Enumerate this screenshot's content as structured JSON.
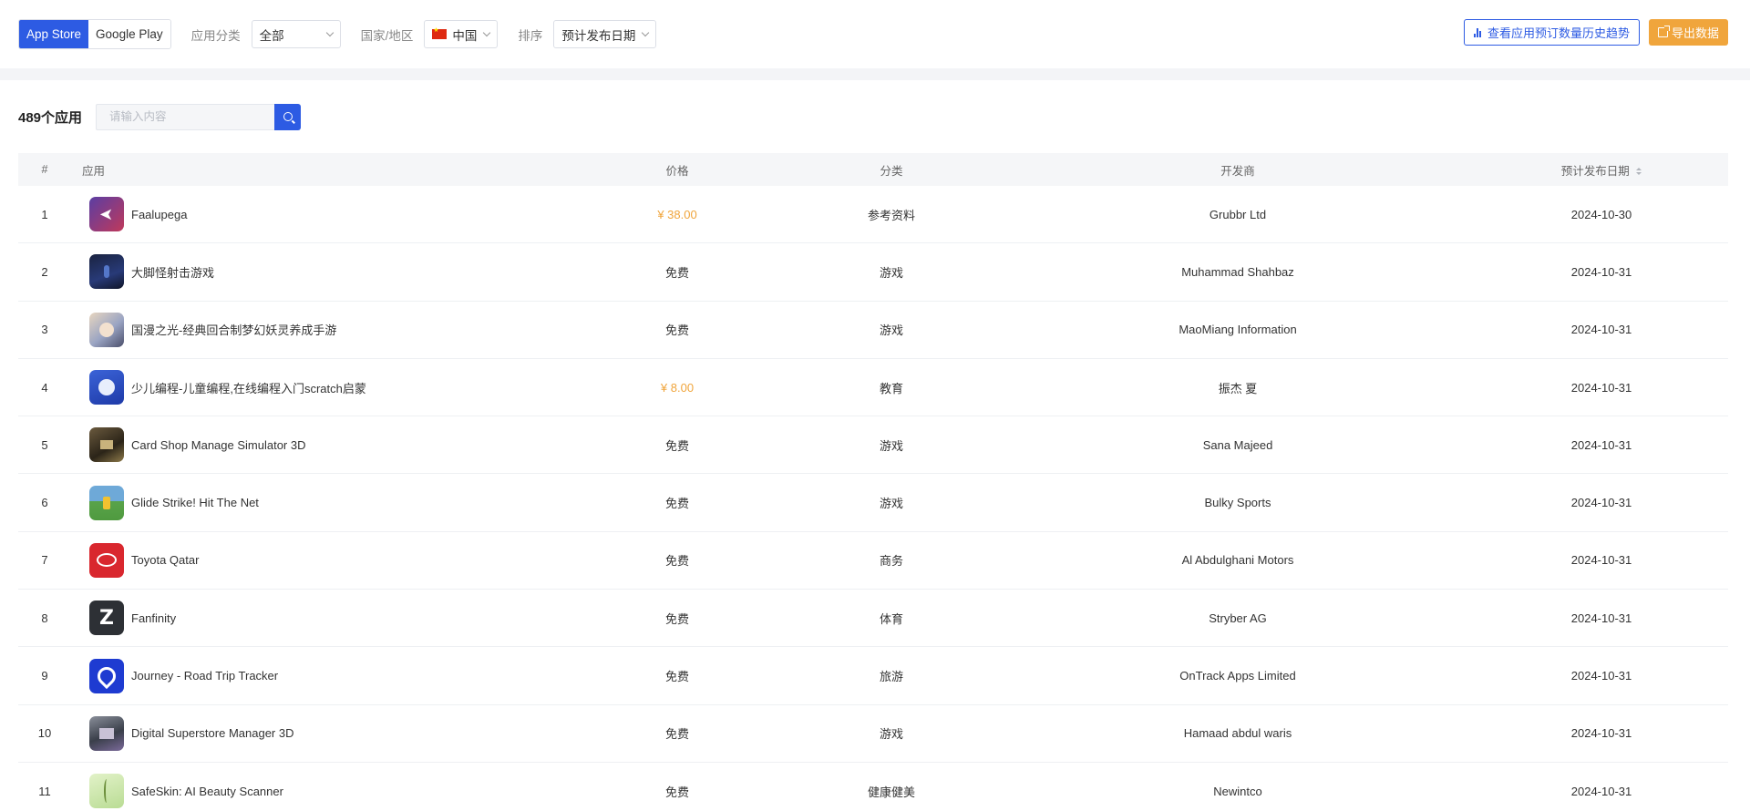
{
  "filters": {
    "store_tabs": [
      {
        "label": "App Store",
        "active": true
      },
      {
        "label": "Google Play",
        "active": false
      }
    ],
    "category_label": "应用分类",
    "category_value": "全部",
    "region_label": "国家/地区",
    "region_value": "中国",
    "sort_label": "排序",
    "sort_value": "预计发布日期"
  },
  "actions": {
    "trend_button": "查看应用预订数量历史趋势",
    "export_button": "导出数据"
  },
  "summary": {
    "app_count": "489个应用",
    "search_placeholder": "请输入内容"
  },
  "table": {
    "columns": {
      "num": "#",
      "app": "应用",
      "price": "价格",
      "category": "分类",
      "developer": "开发商",
      "date": "预计发布日期"
    },
    "rows": [
      {
        "num": "1",
        "name": "Faalupega",
        "price": "¥ 38.00",
        "paid": true,
        "category": "参考资料",
        "developer": "Grubbr Ltd",
        "date": "2024-10-30",
        "icon": "faalupega-app-icon"
      },
      {
        "num": "2",
        "name": "大脚怪射击游戏",
        "price": "免费",
        "paid": false,
        "category": "游戏",
        "developer": "Muhammad Shahbaz",
        "date": "2024-10-31",
        "icon": "bigfoot-shooter-app-icon"
      },
      {
        "num": "3",
        "name": "国漫之光-经典回合制梦幻妖灵养成手游",
        "price": "免费",
        "paid": false,
        "category": "游戏",
        "developer": "MaoMiang Information",
        "date": "2024-10-31",
        "icon": "anime-rpg-app-icon"
      },
      {
        "num": "4",
        "name": "少儿编程-儿童编程,在线编程入门scratch启蒙",
        "price": "¥ 8.00",
        "paid": true,
        "category": "教育",
        "developer": "振杰 夏",
        "date": "2024-10-31",
        "icon": "kids-coding-robot-app-icon"
      },
      {
        "num": "5",
        "name": "Card Shop Manage Simulator 3D",
        "price": "免费",
        "paid": false,
        "category": "游戏",
        "developer": "Sana Majeed",
        "date": "2024-10-31",
        "icon": "card-shop-app-icon"
      },
      {
        "num": "6",
        "name": "Glide Strike! Hit The Net",
        "price": "免费",
        "paid": false,
        "category": "游戏",
        "developer": "Bulky Sports",
        "date": "2024-10-31",
        "icon": "soccer-game-app-icon"
      },
      {
        "num": "7",
        "name": "Toyota Qatar",
        "price": "免费",
        "paid": false,
        "category": "商务",
        "developer": "Al Abdulghani Motors",
        "date": "2024-10-31",
        "icon": "toyota-logo-app-icon"
      },
      {
        "num": "8",
        "name": "Fanfinity",
        "price": "免费",
        "paid": false,
        "category": "体育",
        "developer": "Stryber AG",
        "date": "2024-10-31",
        "icon": "fanfinity-logo-app-icon"
      },
      {
        "num": "9",
        "name": "Journey - Road Trip Tracker",
        "price": "免费",
        "paid": false,
        "category": "旅游",
        "developer": "OnTrack Apps Limited",
        "date": "2024-10-31",
        "icon": "map-pin-app-icon"
      },
      {
        "num": "10",
        "name": "Digital Superstore Manager 3D",
        "price": "免费",
        "paid": false,
        "category": "游戏",
        "developer": "Hamaad abdul waris",
        "date": "2024-10-31",
        "icon": "superstore-app-icon"
      },
      {
        "num": "11",
        "name": "SafeSkin: AI Beauty Scanner",
        "price": "免费",
        "paid": false,
        "category": "健康健美",
        "developer": "Newintco",
        "date": "2024-10-31",
        "icon": "safeskin-app-icon"
      }
    ]
  }
}
